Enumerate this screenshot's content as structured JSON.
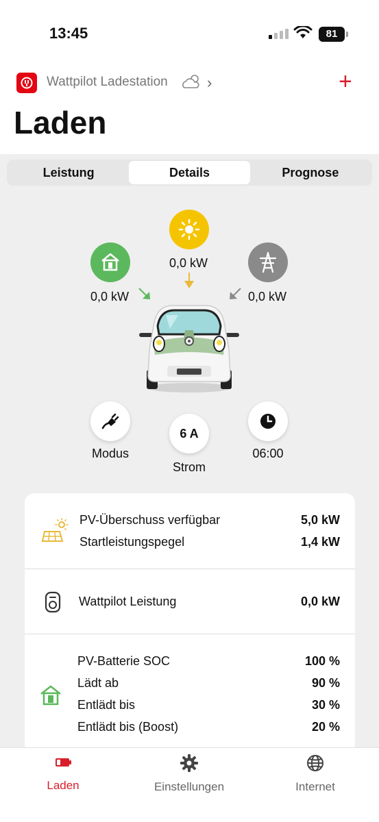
{
  "status_bar": {
    "time": "13:45",
    "battery": "81"
  },
  "header": {
    "station_name": "Wattpilot Ladestation",
    "title": "Laden"
  },
  "tabs": [
    {
      "label": "Leistung",
      "active": false
    },
    {
      "label": "Details",
      "active": true
    },
    {
      "label": "Prognose",
      "active": false
    }
  ],
  "flow": {
    "house": {
      "value": "0,0 kW",
      "color": "#5cb85c"
    },
    "solar": {
      "value": "0,0 kW",
      "color": "#f5c400"
    },
    "grid": {
      "value": "0,0 kW",
      "color": "#8a8a8a"
    }
  },
  "controls": {
    "mode_label": "Modus",
    "current_value": "6 A",
    "current_label": "Strom",
    "time_value": "06:00"
  },
  "details": {
    "pv": [
      {
        "label": "PV-Überschuss verfügbar",
        "value": "5,0 kW"
      },
      {
        "label": "Startleistungspegel",
        "value": "1,4 kW"
      }
    ],
    "wattpilot": {
      "label": "Wattpilot Leistung",
      "value": "0,0 kW"
    },
    "battery": [
      {
        "label": "PV-Batterie SOC",
        "value": "100 %"
      },
      {
        "label": "Lädt ab",
        "value": "90 %"
      },
      {
        "label": "Entlädt bis",
        "value": "30 %"
      },
      {
        "label": "Entlädt bis (Boost)",
        "value": "20 %"
      }
    ]
  },
  "bottom_nav": [
    {
      "label": "Laden",
      "active": true
    },
    {
      "label": "Einstellungen",
      "active": false
    },
    {
      "label": "Internet",
      "active": false
    }
  ],
  "accent_color": "#d81e2b"
}
